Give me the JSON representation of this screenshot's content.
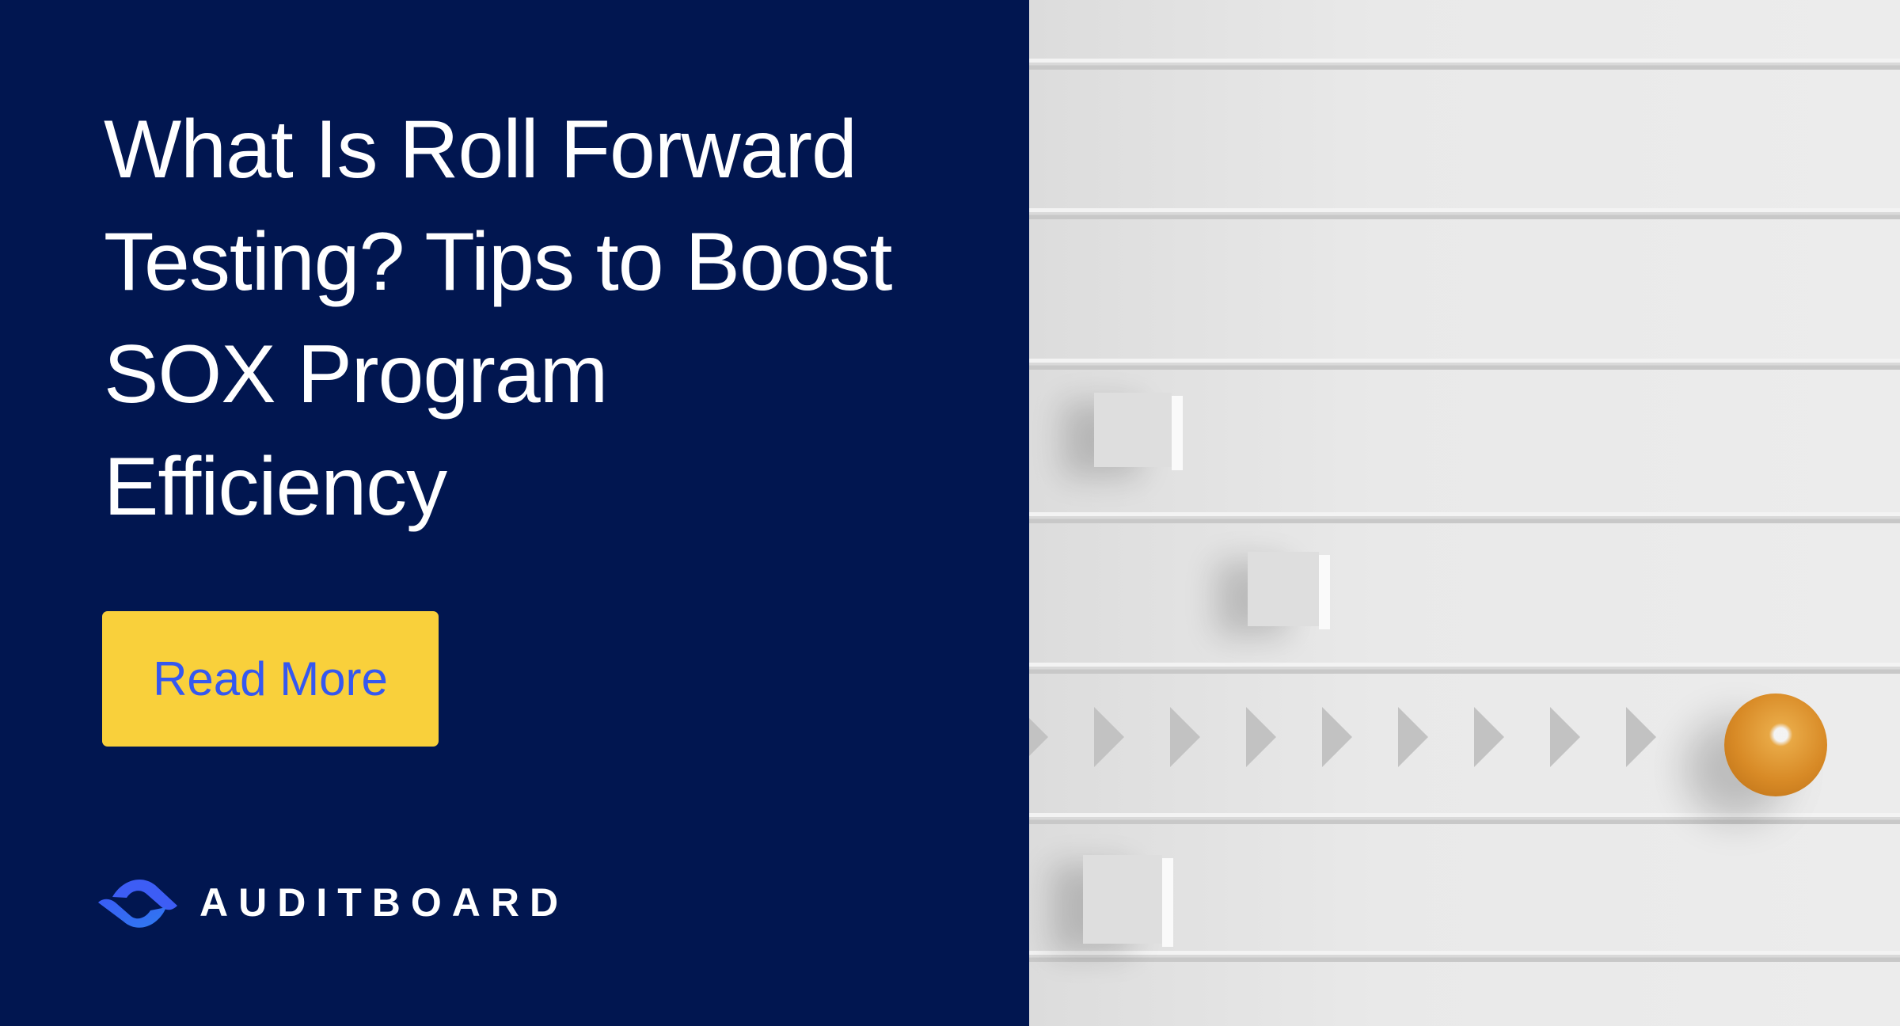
{
  "headline": {
    "lines": [
      "What Is Roll Forward",
      "Testing? Tips to Boost",
      "SOX Program",
      "Efficiency"
    ]
  },
  "cta": {
    "label": "Read More"
  },
  "brand": {
    "name": "AUDITBOARD",
    "logo_icon": "auditboard-logo-icon"
  },
  "colors": {
    "background_navy": "#011650",
    "button_yellow": "#f9d03b",
    "button_text_blue": "#3558f0",
    "accent_ball_orange": "#d88a26"
  },
  "illustration": {
    "description": "3D white surface with grooves, white blocks, arrow markers and an orange ball",
    "arrow_count": 9
  }
}
